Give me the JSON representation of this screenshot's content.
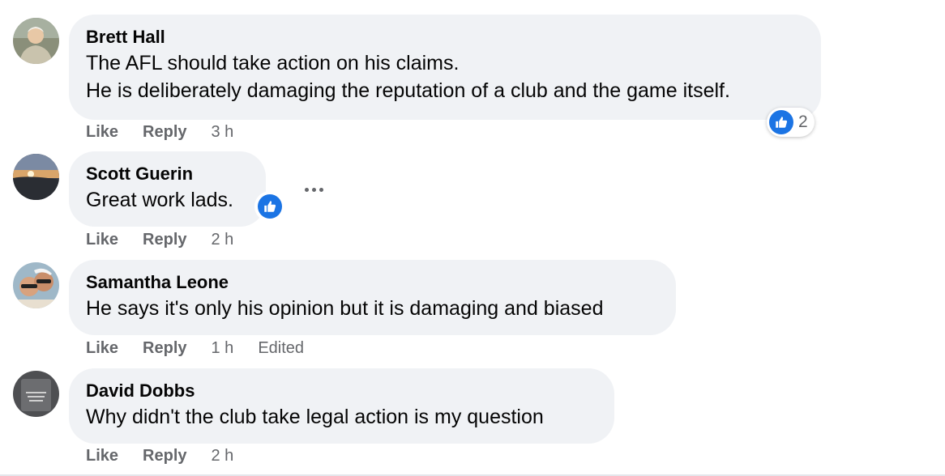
{
  "comments": [
    {
      "author": "Brett Hall",
      "lines": [
        "The AFL should take action on his claims.",
        "He is deliberately damaging the reputation of a club and the game itself."
      ],
      "like": "Like",
      "reply": "Reply",
      "time": "3 h",
      "reactions": {
        "icon": "thumbs-up-icon",
        "count": "2"
      }
    },
    {
      "author": "Scott Guerin",
      "lines": [
        "Great work lads."
      ],
      "like": "Like",
      "reply": "Reply",
      "time": "2 h",
      "reactions": {
        "icon": "thumbs-up-icon"
      }
    },
    {
      "author": "Samantha Leone",
      "lines": [
        "He says it's only his opinion but it is damaging and biased"
      ],
      "like": "Like",
      "reply": "Reply",
      "time": "1 h",
      "edited": "Edited"
    },
    {
      "author": "David Dobbs",
      "lines": [
        "Why didn't the club take legal action is my question"
      ],
      "like": "Like",
      "reply": "Reply",
      "time": "2 h"
    }
  ],
  "colors": {
    "bubble": "#f0f2f5",
    "like_blue": "#1b74e4",
    "meta_gray": "#65676b"
  }
}
